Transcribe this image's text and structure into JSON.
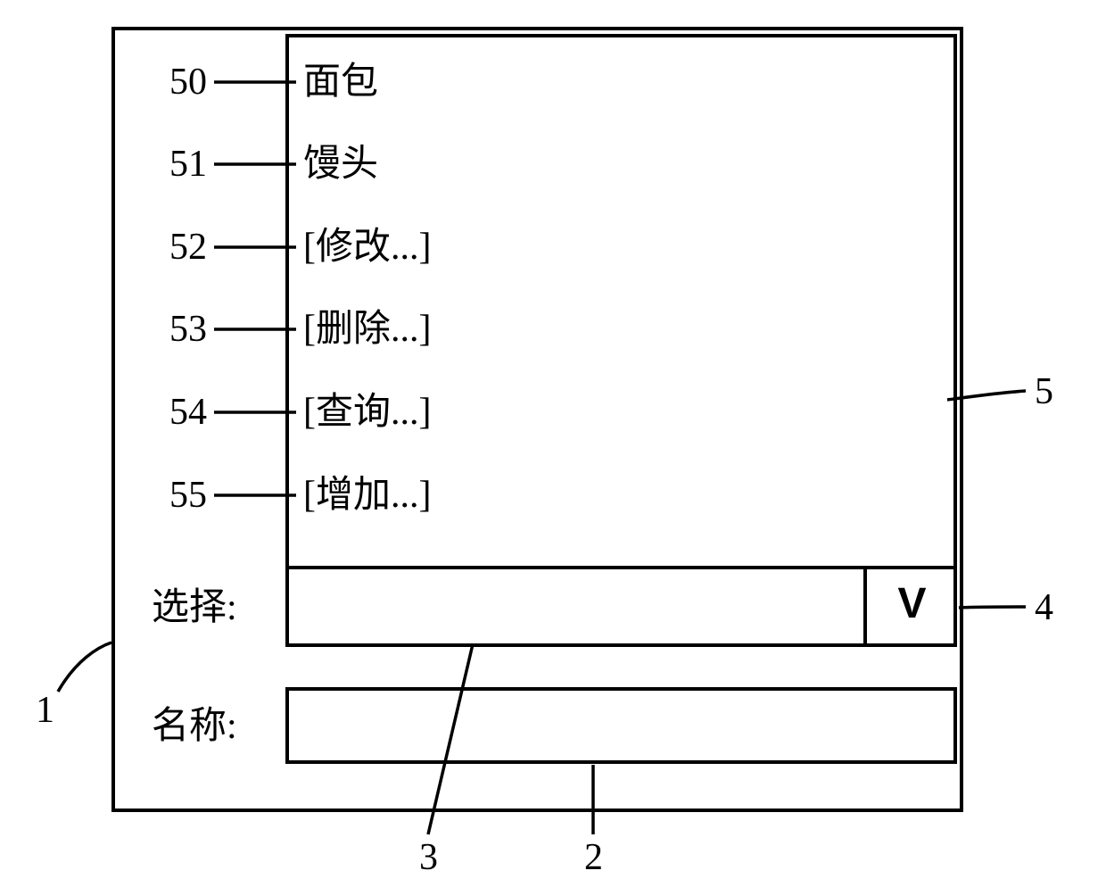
{
  "list": {
    "items": [
      {
        "callout": "50",
        "text": "面包"
      },
      {
        "callout": "51",
        "text": "馒头"
      },
      {
        "callout": "52",
        "text": "[修改...]"
      },
      {
        "callout": "53",
        "text": "[删除...]"
      },
      {
        "callout": "54",
        "text": "[查询...]"
      },
      {
        "callout": "55",
        "text": "[增加...]"
      }
    ]
  },
  "labels": {
    "select": "选择:",
    "name": "名称:"
  },
  "dropdown_glyph": "V",
  "callouts": {
    "frame": "1",
    "name_field": "2",
    "select_field": "3",
    "dropdown_button": "4",
    "list_panel": "5"
  }
}
